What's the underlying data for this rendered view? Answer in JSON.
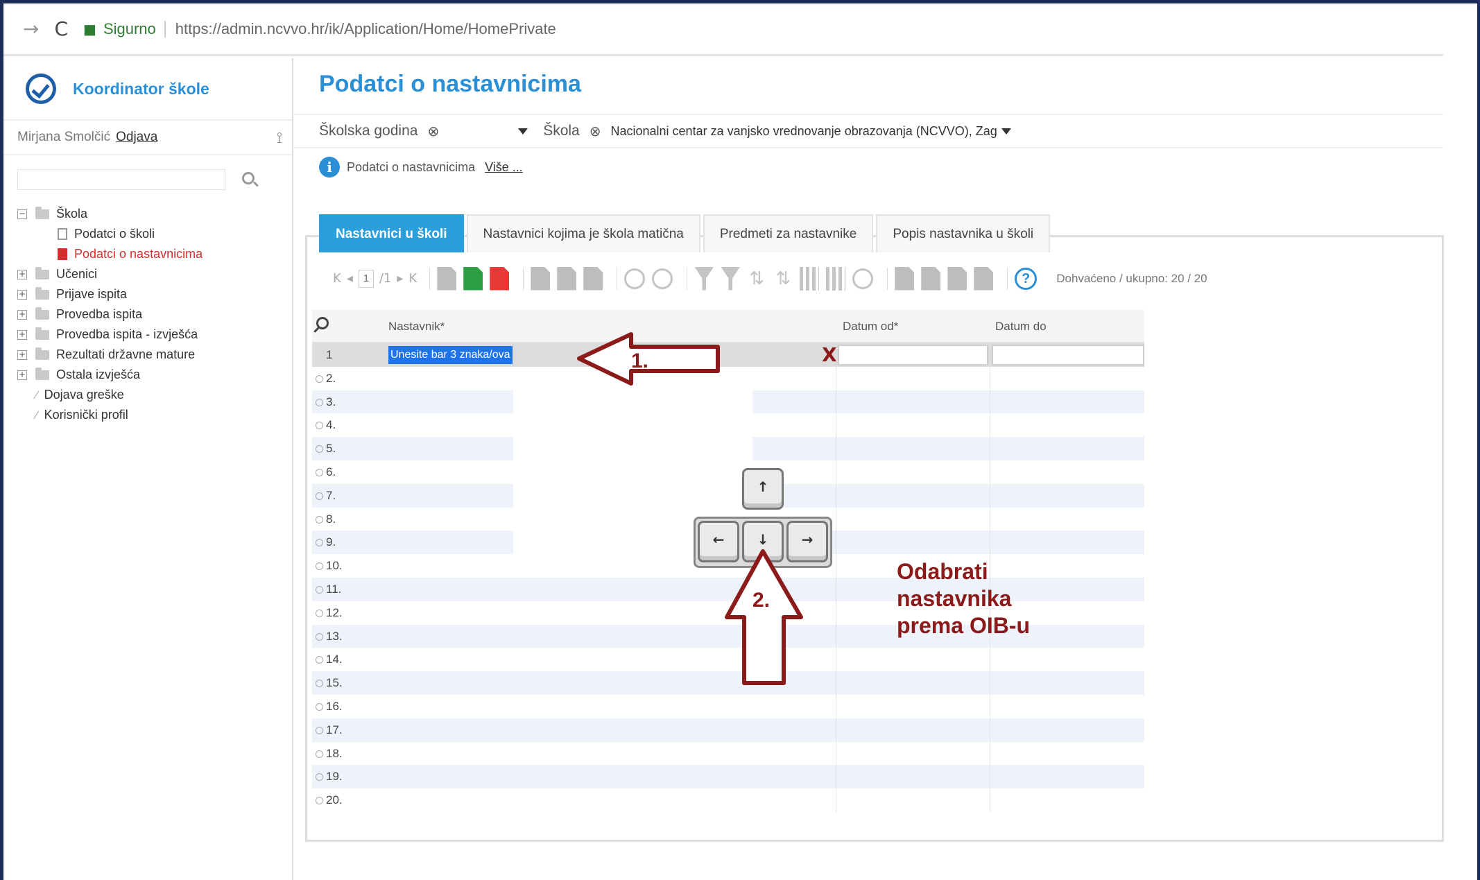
{
  "browser": {
    "back_glyph": "→",
    "reload_glyph": "C",
    "lock_glyph": "■",
    "secure_label": "Sigurno",
    "url": "https://admin.ncvvo.hr/ik/Application/Home/HomePrivate"
  },
  "sidebar": {
    "brand": "Koordinator škole",
    "user_name": "Mirjana Smolčić",
    "logout": "Odjava",
    "pin_glyph": "⟟",
    "tree": [
      {
        "label": "Škola",
        "expander": "−",
        "icon": "folder"
      },
      {
        "label": "Podatci o školi",
        "icon": "doc",
        "child": true
      },
      {
        "label": "Podatci o nastavnicima",
        "icon": "doc-red",
        "child": true,
        "active": true
      },
      {
        "label": "Učenici",
        "expander": "+",
        "icon": "folder"
      },
      {
        "label": "Prijave ispita",
        "expander": "+",
        "icon": "folder"
      },
      {
        "label": "Provedba ispita",
        "expander": "+",
        "icon": "folder"
      },
      {
        "label": "Provedba ispita - izvješća",
        "expander": "+",
        "icon": "folder"
      },
      {
        "label": "Rezultati državne mature",
        "expander": "+",
        "icon": "folder"
      },
      {
        "label": "Ostala izvješća",
        "expander": "+",
        "icon": "folder"
      },
      {
        "label": "Dojava greške",
        "icon": "pen"
      },
      {
        "label": "Korisnički profil",
        "icon": "pen"
      }
    ]
  },
  "main": {
    "title": "Podatci o nastavnicima",
    "filters": {
      "year_label": "Školska godina",
      "clear_glyph": "⊗",
      "school_label": "Škola",
      "school_value": "Nacionalni centar za vanjsko vrednovanje obrazovanja (NCVVO), Zag"
    },
    "info": {
      "icon_glyph": "i",
      "text": "Podatci o nastavnicima",
      "more": "Više ..."
    },
    "tabs": [
      {
        "label": "Nastavnici u školi",
        "active": true
      },
      {
        "label": "Nastavnici kojima je škola matična"
      },
      {
        "label": "Predmeti za nastavnike"
      },
      {
        "label": "Popis nastavnika u školi"
      }
    ],
    "toolbar": {
      "pager_first": "K",
      "pager_prev": "◂",
      "page": "1",
      "page_total": "/1",
      "pager_next": "▸",
      "pager_last": "K",
      "sort_glyph": "⇅",
      "help_glyph": "?",
      "fetched": "Dohvaćeno / ukupno: 20 / 20"
    },
    "grid": {
      "columns": [
        "Nastavnik*",
        "Datum od*",
        "Datum do"
      ],
      "edit_row_number": "1",
      "edit_placeholder": "Unesite bar 3 znaka/ova",
      "delete_glyph": "X",
      "rows": [
        "2.",
        "3.",
        "4.",
        "5.",
        "6.",
        "7.",
        "8.",
        "9.",
        "10.",
        "11.",
        "12.",
        "13.",
        "14.",
        "15.",
        "16.",
        "17.",
        "18.",
        "19.",
        "20."
      ]
    }
  },
  "annotations": {
    "arrow1_label": "1.",
    "arrow2_label": "2.",
    "keys": {
      "up": "↑",
      "left": "←",
      "down": "↓",
      "right": "→"
    },
    "instruction": [
      "Odabrati",
      "nastavnika",
      "prema OIB-u"
    ],
    "color": "#8b1a1a"
  }
}
